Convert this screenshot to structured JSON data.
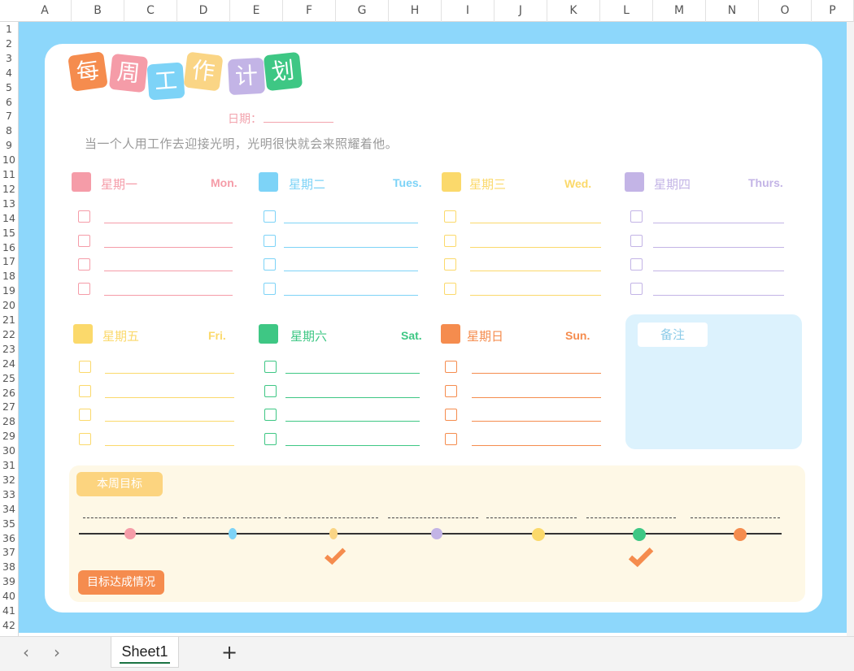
{
  "spreadsheet": {
    "columns": [
      "A",
      "B",
      "C",
      "D",
      "E",
      "F",
      "G",
      "H",
      "I",
      "J",
      "K",
      "L",
      "M",
      "N",
      "O",
      "P"
    ],
    "rows": [
      "1",
      "2",
      "3",
      "4",
      "5",
      "6",
      "7",
      "8",
      "9",
      "10",
      "11",
      "12",
      "13",
      "14",
      "15",
      "16",
      "17",
      "18",
      "19",
      "20",
      "21",
      "22",
      "23",
      "24",
      "25",
      "26",
      "27",
      "28",
      "29",
      "30",
      "31",
      "32",
      "33",
      "34",
      "35",
      "36",
      "37",
      "38",
      "39",
      "40",
      "41",
      "42"
    ],
    "sheet_tab": "Sheet1",
    "nav_prev": "‹",
    "nav_next": "›",
    "add_sheet": "+"
  },
  "planner": {
    "title_chars": [
      "每",
      "周",
      "工",
      "作",
      "计",
      "划"
    ],
    "title_colors": [
      "#f58c4e",
      "#f59ca8",
      "#7dd3f7",
      "#fad585",
      "#c3b4e6",
      "#3ec784"
    ],
    "date_label": "日期：",
    "quote": "当一个人用工作去迎接光明，光明很快就会来照耀着他。",
    "days": [
      {
        "cn": "星期一",
        "en": "Mon.",
        "color": "#f59ca8"
      },
      {
        "cn": "星期二",
        "en": "Tues.",
        "color": "#7dd3f7"
      },
      {
        "cn": "星期三",
        "en": "Wed.",
        "color": "#fbd96b"
      },
      {
        "cn": "星期四",
        "en": "Thurs.",
        "color": "#c3b4e6"
      },
      {
        "cn": "星期五",
        "en": "Fri.",
        "color": "#fbd96b"
      },
      {
        "cn": "星期六",
        "en": "Sat.",
        "color": "#3ec784"
      },
      {
        "cn": "星期日",
        "en": "Sun.",
        "color": "#f58c4e"
      }
    ],
    "notes_label": "备注",
    "weekly_goal_label": "本周目标",
    "goal_status_label": "目标达成情况",
    "timeline_dot_colors": [
      "#f59ca8",
      "#7dd3f7",
      "#fad585",
      "#c3b4e6",
      "#fbd96b",
      "#3ec784",
      "#f58c4e"
    ],
    "achieved": [
      false,
      false,
      true,
      false,
      false,
      true,
      false
    ],
    "check_color": "#f58c4e"
  }
}
